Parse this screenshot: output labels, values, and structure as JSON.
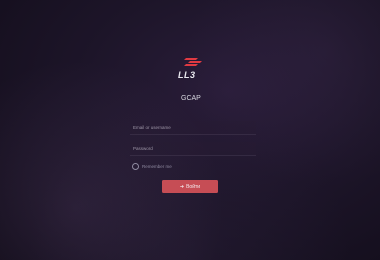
{
  "brand": {
    "logo_text": "LL3",
    "app_name": "GCAP"
  },
  "form": {
    "username_placeholder": "Email or username",
    "password_placeholder": "Password",
    "remember_label": "Remember me",
    "signin_label": "Войти"
  },
  "colors": {
    "accent": "#c64d55",
    "logo_red": "#e03a42"
  },
  "icons": {
    "logo": "ll3-logo-icon",
    "signin": "sign-in-icon"
  }
}
